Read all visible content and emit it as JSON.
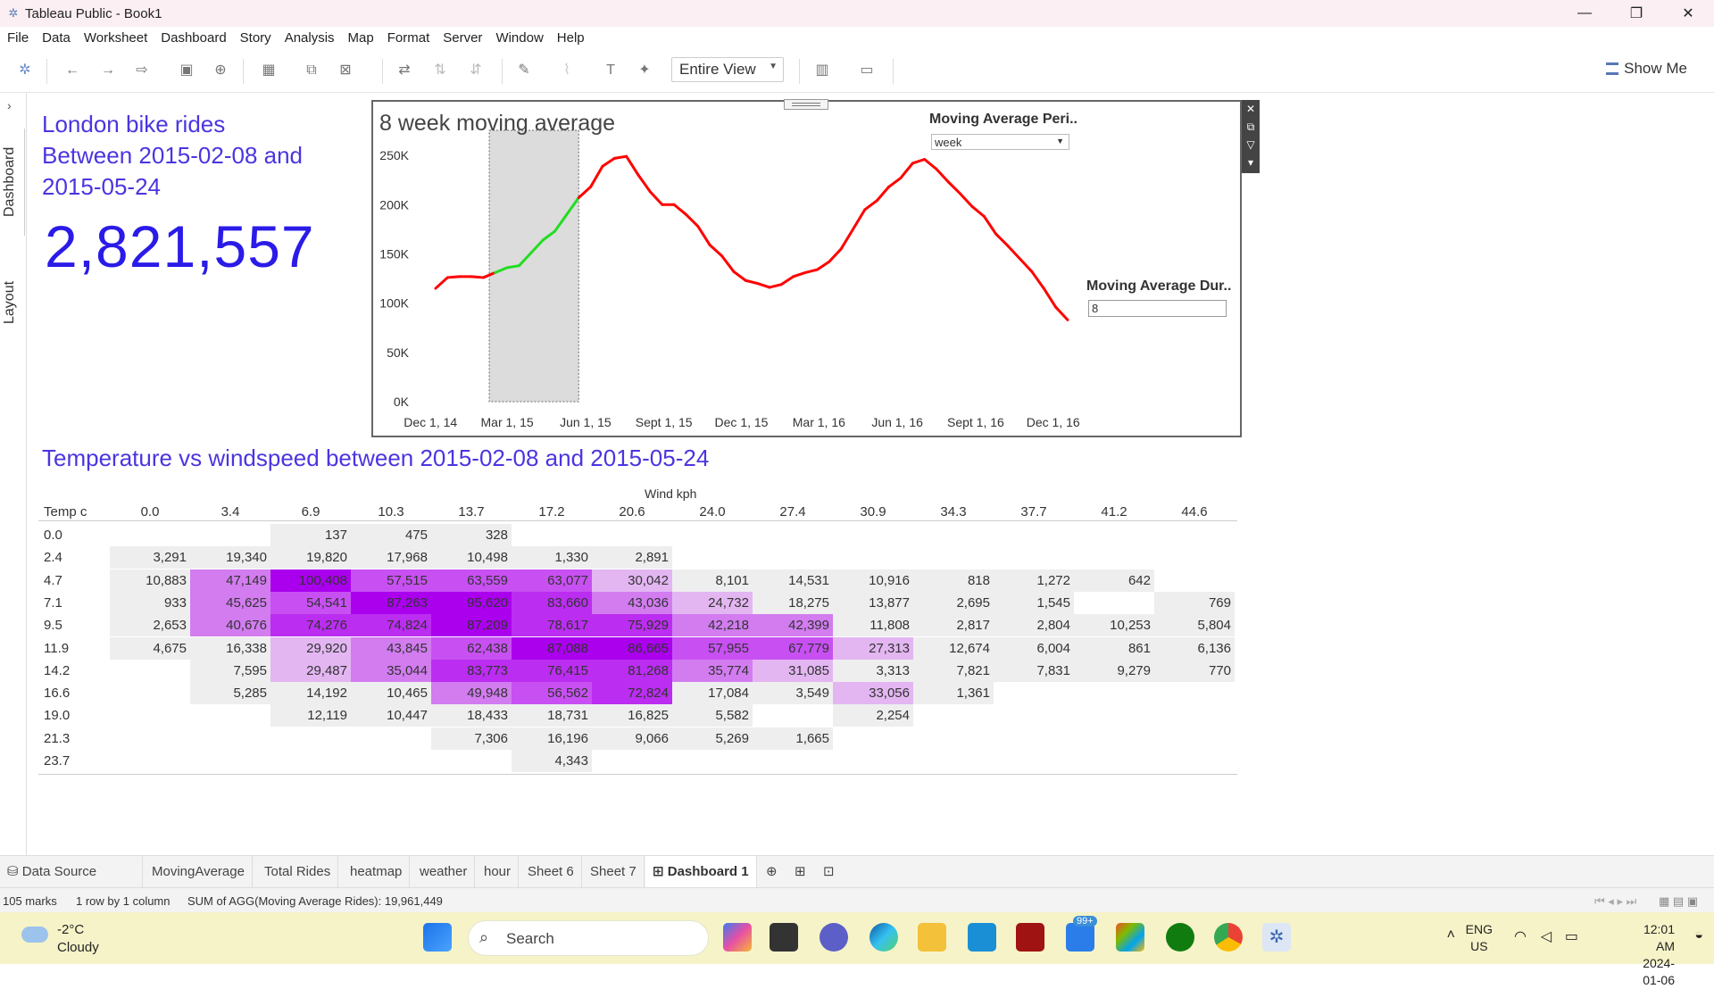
{
  "window": {
    "title": "Tableau Public - Book1",
    "minimize": "—",
    "restore": "❐",
    "close": "✕"
  },
  "menu": [
    "File",
    "Data",
    "Worksheet",
    "Dashboard",
    "Story",
    "Analysis",
    "Map",
    "Format",
    "Server",
    "Window",
    "Help"
  ],
  "toolbar": {
    "view_select": "Entire View",
    "show_me": "Show Me"
  },
  "sidebar": {
    "tabs": [
      "Dashboard",
      "Layout"
    ]
  },
  "summary": {
    "title": "London bike rides Between 2015-02-08 and 2015-05-24",
    "total": "2,821,557"
  },
  "chart_panel": {
    "title": "8  week moving average",
    "period_label": "Moving Average Peri..",
    "period_value": "week",
    "duration_label": "Moving Average Dur..",
    "duration_value": "8"
  },
  "chart_data": {
    "type": "line",
    "title": "8  week moving average",
    "y_ticks": [
      "0K",
      "50K",
      "100K",
      "150K",
      "200K",
      "250K"
    ],
    "x_ticks": [
      "Dec 1, 14",
      "Mar 1, 15",
      "Jun 1, 15",
      "Sept 1, 15",
      "Dec 1, 15",
      "Mar 1, 16",
      "Jun 1, 16",
      "Sept 1, 16",
      "Dec 1, 16"
    ],
    "ylim": [
      0,
      270000
    ],
    "xlim": [
      "2014-11-14",
      "2017-01-08"
    ],
    "highlight_range": [
      "2015-02-08",
      "2015-05-24"
    ],
    "series": [
      {
        "color_inside_range": "#22dd22",
        "color_outside_range": "#ff0000",
        "x": [
          "2014-12-07",
          "2014-12-21",
          "2015-01-04",
          "2015-01-18",
          "2015-02-01",
          "2015-02-15",
          "2015-03-01",
          "2015-03-15",
          "2015-03-29",
          "2015-04-12",
          "2015-04-26",
          "2015-05-10",
          "2015-05-24",
          "2015-06-07",
          "2015-06-21",
          "2015-07-05",
          "2015-07-19",
          "2015-08-02",
          "2015-08-16",
          "2015-08-30",
          "2015-09-13",
          "2015-09-27",
          "2015-10-11",
          "2015-10-25",
          "2015-11-08",
          "2015-11-22",
          "2015-12-06",
          "2015-12-20",
          "2016-01-03",
          "2016-01-17",
          "2016-01-31",
          "2016-02-14",
          "2016-02-28",
          "2016-03-13",
          "2016-03-27",
          "2016-04-10",
          "2016-04-24",
          "2016-05-08",
          "2016-05-22",
          "2016-06-05",
          "2016-06-19",
          "2016-07-03",
          "2016-07-17",
          "2016-07-31",
          "2016-08-14",
          "2016-08-28",
          "2016-09-11",
          "2016-09-25",
          "2016-10-09",
          "2016-10-23",
          "2016-11-06",
          "2016-11-20",
          "2016-12-04",
          "2016-12-18"
        ],
        "y": [
          115000,
          126000,
          127000,
          127000,
          126000,
          131000,
          136000,
          138000,
          151000,
          164000,
          173000,
          190000,
          207000,
          218000,
          239000,
          247000,
          249000,
          230000,
          213000,
          200000,
          200000,
          190000,
          178000,
          159000,
          148000,
          132000,
          123000,
          120000,
          116000,
          119000,
          127000,
          131000,
          134000,
          142000,
          155000,
          175000,
          195000,
          204000,
          218000,
          227000,
          242000,
          246000,
          236000,
          223000,
          211000,
          198000,
          188000,
          170000,
          158000,
          145000,
          132000,
          115000,
          96000,
          83000
        ]
      }
    ]
  },
  "heatmap": {
    "title": "Temperature vs windspeed between 2015-02-08 and 2015-05-24",
    "col_axis_label": "Wind kph",
    "row_axis_label": "Temp c",
    "columns": [
      "0.0",
      "3.4",
      "6.9",
      "10.3",
      "13.7",
      "17.2",
      "20.6",
      "24.0",
      "27.4",
      "30.9",
      "34.3",
      "37.7",
      "41.2",
      "44.6"
    ],
    "rows": [
      "0.0",
      "2.4",
      "4.7",
      "7.1",
      "9.5",
      "11.9",
      "14.2",
      "16.6",
      "19.0",
      "21.3",
      "23.7"
    ],
    "values": [
      [
        null,
        null,
        137,
        475,
        328,
        null,
        null,
        null,
        null,
        null,
        null,
        null,
        null,
        null
      ],
      [
        3291,
        19340,
        19820,
        17968,
        10498,
        1330,
        2891,
        null,
        null,
        null,
        null,
        null,
        null,
        null
      ],
      [
        10883,
        47149,
        100408,
        57515,
        63559,
        63077,
        30042,
        8101,
        14531,
        10916,
        818,
        1272,
        642,
        null
      ],
      [
        933,
        45625,
        54541,
        87263,
        95620,
        83660,
        43036,
        24732,
        18275,
        13877,
        2695,
        1545,
        null,
        769
      ],
      [
        2653,
        40676,
        74276,
        74824,
        87209,
        78617,
        75929,
        42218,
        42399,
        11808,
        2817,
        2804,
        10253,
        5804
      ],
      [
        4675,
        16338,
        29920,
        43845,
        62438,
        87088,
        86665,
        57955,
        67779,
        27313,
        12674,
        6004,
        861,
        6136
      ],
      [
        null,
        7595,
        29487,
        35044,
        83773,
        76415,
        81268,
        35774,
        31085,
        3313,
        7821,
        7831,
        9279,
        770
      ],
      [
        null,
        5285,
        14192,
        10465,
        49948,
        56562,
        72824,
        17084,
        3549,
        33056,
        1361,
        null,
        null,
        null
      ],
      [
        null,
        null,
        12119,
        10447,
        18433,
        18731,
        16825,
        5582,
        null,
        2254,
        null,
        null,
        null,
        null
      ],
      [
        null,
        null,
        null,
        null,
        7306,
        16196,
        9066,
        5269,
        1665,
        null,
        null,
        null,
        null,
        null
      ],
      [
        null,
        null,
        null,
        null,
        null,
        4343,
        null,
        null,
        null,
        null,
        null,
        null,
        null,
        null
      ]
    ]
  },
  "sheet_tabs": [
    "Data Source",
    "MovingAverage",
    "Total Rides",
    "heatmap",
    "weather",
    "hour",
    "Sheet 6",
    "Sheet 7",
    "Dashboard 1"
  ],
  "status": {
    "marks": "105 marks",
    "dims": "1 row by 1 column",
    "sum": "SUM of AGG(Moving Average Rides): 19,961,449"
  },
  "taskbar": {
    "temp": "-2°C",
    "weather": "Cloudy",
    "search": "Search",
    "badge": "99+",
    "lang1": "ENG",
    "lang2": "US",
    "time": "12:01 AM",
    "date": "2024-01-06"
  }
}
